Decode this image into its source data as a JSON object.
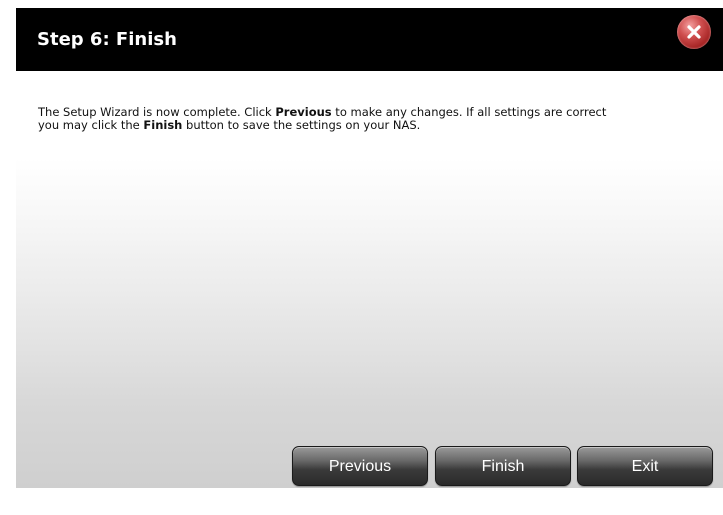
{
  "dialog": {
    "title": "Step 6: Finish",
    "close_icon": "close-icon",
    "message": {
      "part1": "The Setup Wizard is now complete. Click ",
      "previous_word": "Previous",
      "part2": " to make any changes. If all settings are correct",
      "part3": "you may click the ",
      "finish_word": "Finish",
      "part4": " button to save the settings on your NAS."
    }
  },
  "buttons": {
    "previous": "Previous",
    "finish": "Finish",
    "exit": "Exit"
  },
  "colors": {
    "title_bar": "#000000",
    "close_button": "#b52a2a",
    "button_dark": "#3a3a3a"
  }
}
